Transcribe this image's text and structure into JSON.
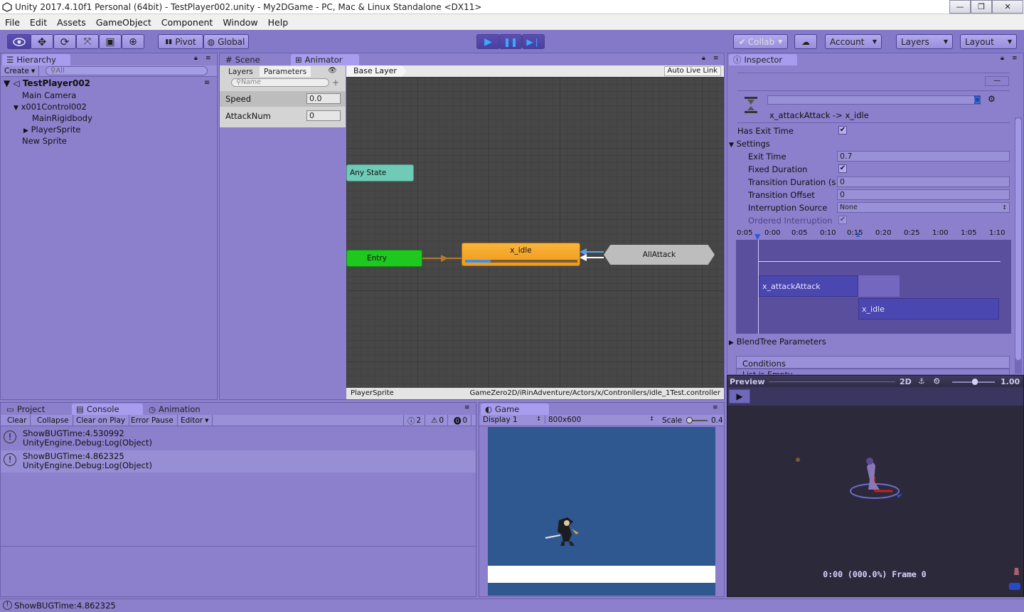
{
  "window": {
    "title": "Unity 2017.4.10f1 Personal (64bit) - TestPlayer002.unity - My2DGame - PC, Mac & Linux Standalone <DX11>",
    "buttons": [
      "—",
      "❐",
      "✕"
    ]
  },
  "menu": [
    "File",
    "Edit",
    "Assets",
    "GameObject",
    "Component",
    "Window",
    "Help"
  ],
  "toolbar": {
    "pivot": "Pivot",
    "global": "Global",
    "collab": "Collab",
    "account": "Account",
    "layers": "Layers",
    "layout": "Layout"
  },
  "hierarchy": {
    "tab": "Hierarchy",
    "create": "Create",
    "search_placeholder": "All",
    "scene": "TestPlayer002",
    "items": [
      "Main Camera",
      "x001Control002",
      "MainRigidbody",
      "PlayerSprite",
      "New Sprite"
    ]
  },
  "scene_tab": "Scene",
  "animator": {
    "tab": "Animator",
    "layers_tab": "Layers",
    "params_tab": "Parameters",
    "name_placeholder": "Name",
    "params": [
      {
        "name": "Speed",
        "value": "0.0"
      },
      {
        "name": "AttackNum",
        "value": "0"
      }
    ],
    "base_layer": "Base Layer",
    "auto_live_link": "Auto Live Link",
    "nodes": {
      "any_state": "Any State",
      "entry": "Entry",
      "idle": "x_idle",
      "allattack": "AllAttack"
    },
    "footer_left": "PlayerSprite",
    "footer_right": "GameZero2D/iRinAdventure/Actors/x/Contronllers/idle_1Test.controller"
  },
  "inspector": {
    "tab": "Inspector",
    "transition_title": "x_attackAttack -> x_idle",
    "has_exit_time": "Has Exit Time",
    "settings": "Settings",
    "exit_time": {
      "label": "Exit Time",
      "value": "0.7"
    },
    "fixed_duration": "Fixed Duration",
    "transition_duration": {
      "label": "Transition Duration (s",
      "value": "0"
    },
    "transition_offset": {
      "label": "Transition Offset",
      "value": "0"
    },
    "interruption_source": {
      "label": "Interruption Source",
      "value": "None"
    },
    "ordered_interruption": "Ordered Interruption",
    "timeline_ticks": [
      "0:05",
      "0:00",
      "0:05",
      "0:10",
      "0:15",
      "0:20",
      "0:25",
      "1:00",
      "1:05",
      "1:10"
    ],
    "clip_from": "x_attackAttack",
    "clip_to": "x_idle",
    "blendtree": "BlendTree Parameters",
    "conditions": "Conditions",
    "list_empty": "List is Empty"
  },
  "preview": {
    "label": "Preview",
    "mode": "2D",
    "speed": "1.00",
    "frame_info": "0:00 (000.0%) Frame 0"
  },
  "bottom_tabs": {
    "project": "Project",
    "console": "Console",
    "animation": "Animation"
  },
  "console": {
    "buttons": [
      "Clear",
      "Collapse",
      "Clear on Play",
      "Error Pause",
      "Editor"
    ],
    "counts": {
      "info": "2",
      "warn": "0",
      "error": "0"
    },
    "logs": [
      {
        "line1": "ShowBUGTime:4.530992",
        "line2": "UnityEngine.Debug:Log(Object)"
      },
      {
        "line1": "ShowBUGTime:4.862325",
        "line2": "UnityEngine.Debug:Log(Object)"
      }
    ]
  },
  "game": {
    "tab": "Game",
    "display": "Display 1",
    "resolution": "800x600",
    "scale_label": "Scale",
    "scale_value": "0.4"
  },
  "status": "ShowBUGTime:4.862325"
}
